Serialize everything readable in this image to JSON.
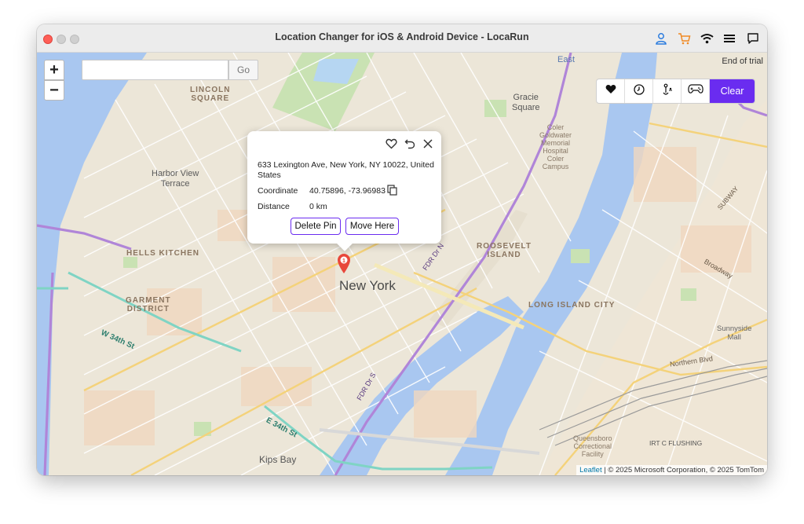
{
  "window": {
    "title": "Location Changer for iOS & Android Device - LocaRun",
    "titlebar_icons": [
      "user-icon",
      "cart-icon",
      "wifi-icon",
      "menu-icon",
      "chat-icon"
    ]
  },
  "map": {
    "zoom_in": "+",
    "zoom_out": "−",
    "search": {
      "value": "",
      "placeholder": ""
    },
    "go_label": "Go",
    "trial_text": "End of trial",
    "toolbar": {
      "buttons": [
        "heart-icon",
        "clock-icon",
        "multi-stop-icon",
        "gamepad-icon"
      ],
      "clear_label": "Clear"
    },
    "popup": {
      "address": "633 Lexington Ave, New York, NY 10022, United States",
      "coordinate_label": "Coordinate",
      "coordinate_value": "40.75896, -73.96983",
      "distance_label": "Distance",
      "distance_value": "0 km",
      "delete_label": "Delete Pin",
      "move_label": "Move Here"
    },
    "labels": {
      "new_york": "New York",
      "lincoln_square": "LINCOLN\nSQUARE",
      "harbor_view": "Harbor View\nTerrace",
      "hells_kitchen": "HELLS KITCHEN",
      "garment": "GARMENT\nDISTRICT",
      "gracie": "Gracie\nSquare",
      "roosevelt": "ROOSEVELT\nISLAND",
      "lic": "LONG ISLAND CITY",
      "kips_bay": "Kips Bay",
      "sunnyside": "Sunnyside\nMall",
      "coler": "Coler\nGoldwater\nMemorial\nHospital\nColer\nCampus",
      "queensboro": "Queensboro\nCorrectional\nFacility",
      "east": "East",
      "w34": "W 34th St",
      "e34": "E 34th St",
      "fdr": "FDR Dr N",
      "fdr2": "FDR Dr S",
      "broadway": "Broadway",
      "northern": "Northern Blvd",
      "subway": "SUBWAY",
      "irtc": "IRT C FLUSHING"
    },
    "attribution": {
      "leaflet": "Leaflet",
      "rest": " | © 2025 Microsoft Corporation, © 2025 TomTom"
    }
  },
  "colors": {
    "accent": "#6a2cf0",
    "water": "#a9c7f0",
    "park": "#c9e2b3",
    "land": "#ece6d8",
    "highway": "#b085d8",
    "pin": "#e8473b"
  }
}
